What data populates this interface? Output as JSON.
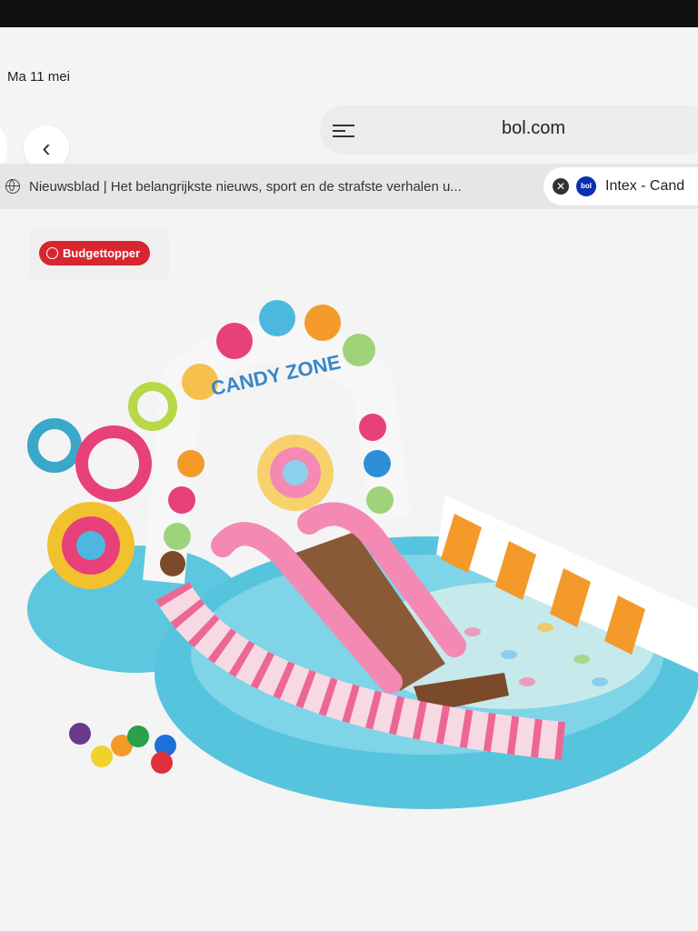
{
  "status_bar": {
    "time_date": "Ma 11 mei"
  },
  "address_bar": {
    "url": "bol.com"
  },
  "tabs": [
    {
      "label": "Nieuwsblad | Het belangrijkste nieuws, sport en de strafste verhalen u...",
      "active": false
    },
    {
      "label": "Intex - Cand",
      "active": true,
      "favicon_text": "bol"
    }
  ],
  "product": {
    "badge": "Budgettopper",
    "image_text": "CANDY ZONE"
  },
  "colors": {
    "badge": "#d7262f",
    "pool_blue": "#56c4dd",
    "favicon": "#0a2fb0"
  }
}
